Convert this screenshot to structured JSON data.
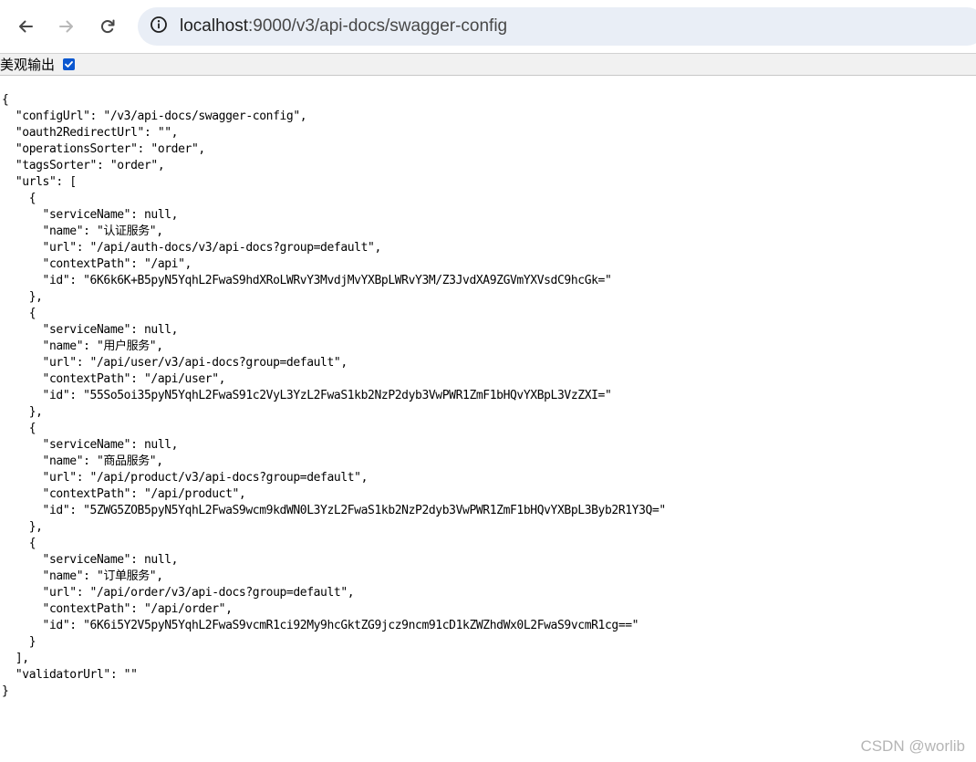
{
  "browser": {
    "url_host": "localhost",
    "url_rest": ":9000/v3/api-docs/swagger-config",
    "back_icon": "arrow-left-icon",
    "forward_icon": "arrow-right-icon",
    "reload_icon": "reload-icon",
    "site_info_icon": "info-circle-icon",
    "forward_enabled": false
  },
  "pretty_print": {
    "label": "美观输出",
    "checked": true,
    "checkbox_color": "#0b57d0"
  },
  "json_lines": [
    "{",
    "  \"configUrl\": \"/v3/api-docs/swagger-config\",",
    "  \"oauth2RedirectUrl\": \"\",",
    "  \"operationsSorter\": \"order\",",
    "  \"tagsSorter\": \"order\",",
    "  \"urls\": [",
    "    {",
    "      \"serviceName\": null,",
    "      \"name\": \"认证服务\",",
    "      \"url\": \"/api/auth-docs/v3/api-docs?group=default\",",
    "      \"contextPath\": \"/api\",",
    "      \"id\": \"6K6k6K+B5pyN5YqhL2FwaS9hdXRoLWRvY3MvdjMvYXBpLWRvY3M/Z3JvdXA9ZGVmYXVsdC9hcGk=\"",
    "    },",
    "    {",
    "      \"serviceName\": null,",
    "      \"name\": \"用户服务\",",
    "      \"url\": \"/api/user/v3/api-docs?group=default\",",
    "      \"contextPath\": \"/api/user\",",
    "      \"id\": \"55So5oi35pyN5YqhL2FwaS91c2VyL3YzL2FwaS1kb2NzP2dyb3VwPWR1ZmF1bHQvYXBpL3VzZXI=\"",
    "    },",
    "    {",
    "      \"serviceName\": null,",
    "      \"name\": \"商品服务\",",
    "      \"url\": \"/api/product/v3/api-docs?group=default\",",
    "      \"contextPath\": \"/api/product\",",
    "      \"id\": \"5ZWG5ZOB5pyN5YqhL2FwaS9wcm9kdWN0L3YzL2FwaS1kb2NzP2dyb3VwPWR1ZmF1bHQvYXBpL3Byb2R1Y3Q=\"",
    "    },",
    "    {",
    "      \"serviceName\": null,",
    "      \"name\": \"订单服务\",",
    "      \"url\": \"/api/order/v3/api-docs?group=default\",",
    "      \"contextPath\": \"/api/order\",",
    "      \"id\": \"6K6i5Y2V5pyN5YqhL2FwaS9vcmR1ci92My9hcGktZG9jcz9ncm91cD1kZWZhdWx0L2FwaS9vcmR1cg==\"",
    "    }",
    "  ],",
    "  \"validatorUrl\": \"\"",
    "}"
  ],
  "watermark": "CSDN @worlib"
}
